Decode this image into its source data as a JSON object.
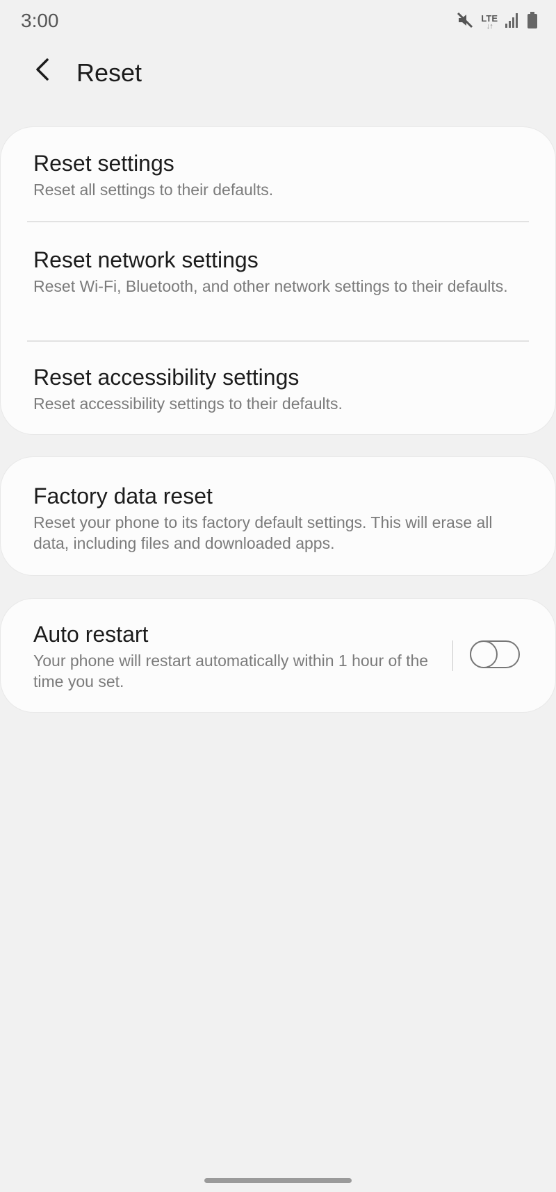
{
  "status_bar": {
    "time": "3:00",
    "network_label": "LTE",
    "network_arrows": "↓↑",
    "icons": [
      "mute-icon",
      "lte-icon",
      "signal-icon",
      "battery-icon"
    ]
  },
  "header": {
    "back_icon": "chevron-left-icon",
    "title": "Reset"
  },
  "groups": [
    {
      "items": [
        {
          "title": "Reset settings",
          "subtitle": "Reset all settings to their defaults."
        },
        {
          "title": "Reset network settings",
          "subtitle": "Reset Wi-Fi, Bluetooth, and other network settings to their defaults."
        },
        {
          "title": "Reset accessibility settings",
          "subtitle": "Reset accessibility settings to their defaults."
        }
      ]
    },
    {
      "items": [
        {
          "title": "Factory data reset",
          "subtitle": "Reset your phone to its factory default settings. This will erase all data, including files and downloaded apps."
        }
      ]
    },
    {
      "items": [
        {
          "title": "Auto restart",
          "subtitle": "Your phone will restart automatically within 1 hour of the time you set.",
          "toggle_on": false
        }
      ]
    }
  ],
  "colors": {
    "background": "#f1f1f1",
    "card": "#fcfcfc",
    "title_text": "#1c1c1c",
    "subtitle_text": "#7b7b7b"
  }
}
